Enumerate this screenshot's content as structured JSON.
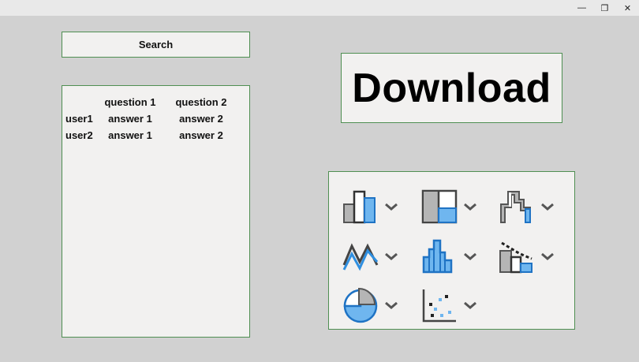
{
  "window": {
    "minimize_glyph": "—",
    "restore_glyph": "❐",
    "close_glyph": "✕"
  },
  "search_button": {
    "label": "Search"
  },
  "download_button": {
    "label": "Download"
  },
  "table": {
    "headers": [
      "",
      "question 1",
      "question 2"
    ],
    "rows": [
      [
        "user1",
        "answer 1",
        "answer 2"
      ],
      [
        "user2",
        "answer 1",
        "answer 2"
      ]
    ]
  },
  "chart_types": [
    {
      "icon": "column-chart-icon"
    },
    {
      "icon": "treemap-chart-icon"
    },
    {
      "icon": "waterfall-chart-icon"
    },
    {
      "icon": "line-chart-icon"
    },
    {
      "icon": "histogram-chart-icon"
    },
    {
      "icon": "combo-chart-icon"
    },
    {
      "icon": "pie-chart-icon"
    },
    {
      "icon": "scatter-chart-icon"
    }
  ],
  "colors": {
    "accent_blue": "#1f73c4",
    "light_blue": "#6fb6ef",
    "gray_fill": "#b5b5b5",
    "border_green": "#4f8f52"
  }
}
